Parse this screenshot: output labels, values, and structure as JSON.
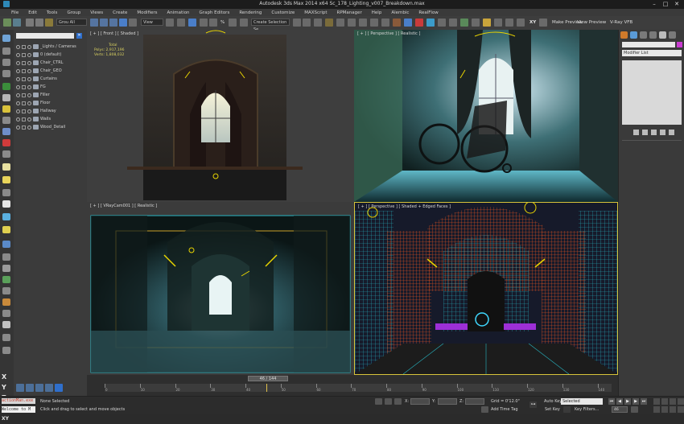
{
  "window": {
    "title": "Autodesk 3ds Max 2014 x64     Sc_178_Lighting_v007_Breakdown.max",
    "minimize": "–",
    "maximize": "□",
    "close": "✕"
  },
  "menubar": {
    "items": [
      "File",
      "Edit",
      "Tools",
      "Group",
      "Views",
      "Create",
      "Modifiers",
      "Animation",
      "Graph Editors",
      "Rendering",
      "Customize",
      "MAXScript",
      "RPManager",
      "Help",
      "Alembic",
      "RealFlow"
    ]
  },
  "toolbar": {
    "selection_filter": "Grou All",
    "view_dropdown": "View",
    "percent_label": "%",
    "named_selection": "Create Selection Se",
    "make_preview": "Make Preview",
    "view_preview": "View Preview",
    "vray_vfb": "V-Ray VFB"
  },
  "scene_explorer": {
    "layers": [
      {
        "name": "_Lights / Cameras"
      },
      {
        "name": "0 (default)"
      },
      {
        "name": "Chair_CTRL"
      },
      {
        "name": "Chair_GEO"
      },
      {
        "name": "Curtains"
      },
      {
        "name": "FG"
      },
      {
        "name": "Filler"
      },
      {
        "name": "Floor"
      },
      {
        "name": "Hallway"
      },
      {
        "name": "Walls"
      },
      {
        "name": "Wood_Detail"
      }
    ]
  },
  "viewports": {
    "front": {
      "label": "[ + ] [ Front ] [ Shaded ]",
      "stats_title": "Total",
      "polys_label": "Polys:",
      "polys_value": "2,917,196",
      "verts_label": "Verts:",
      "verts_value": "1,808,032"
    },
    "perspective_top": {
      "label": "[ + ] [ Perspective ] [ Realistic ]"
    },
    "camera": {
      "label": "[ + ] [ VRayCam001 ] [ Realistic ]"
    },
    "perspective_bottom": {
      "label": "[ + ] [ Perspective ] [ Shaded + Edged Faces ]"
    }
  },
  "command_panel": {
    "modifier_list": "Modifier List"
  },
  "timeline": {
    "current_frame": "46 / 144",
    "tick_labels": [
      "0",
      "10",
      "20",
      "30",
      "40",
      "50",
      "60",
      "70",
      "80",
      "90",
      "100",
      "110",
      "120",
      "130",
      "140"
    ],
    "current_frame_value": 46,
    "frame_count": 144
  },
  "statusbar": {
    "maxscript_label": "actionMan.exe",
    "maxscript_input": "Welcome to M",
    "selection_status": "None Selected",
    "prompt": "Click and drag to select and move objects",
    "x_label": "X:",
    "y_label": "Y:",
    "z_label": "Z:",
    "grid": "Grid = 0'12.0\"",
    "add_time_tag": "Add Time Tag",
    "auto_key": "Auto Key",
    "selected_dropdown": "Selected",
    "set_key": "Set Key",
    "key_filters": "Key Filters...",
    "frame_field": "46"
  },
  "axis_constraints": {
    "x": "X",
    "y": "Y",
    "z": "Z",
    "xy": "XY",
    "xy2": "XY"
  },
  "colors": {
    "wire_orange": "#ff5a1e",
    "wire_cyan": "#26b8c4",
    "active_border": "#d7c33a",
    "gizmo_yellow": "#e8d400"
  }
}
